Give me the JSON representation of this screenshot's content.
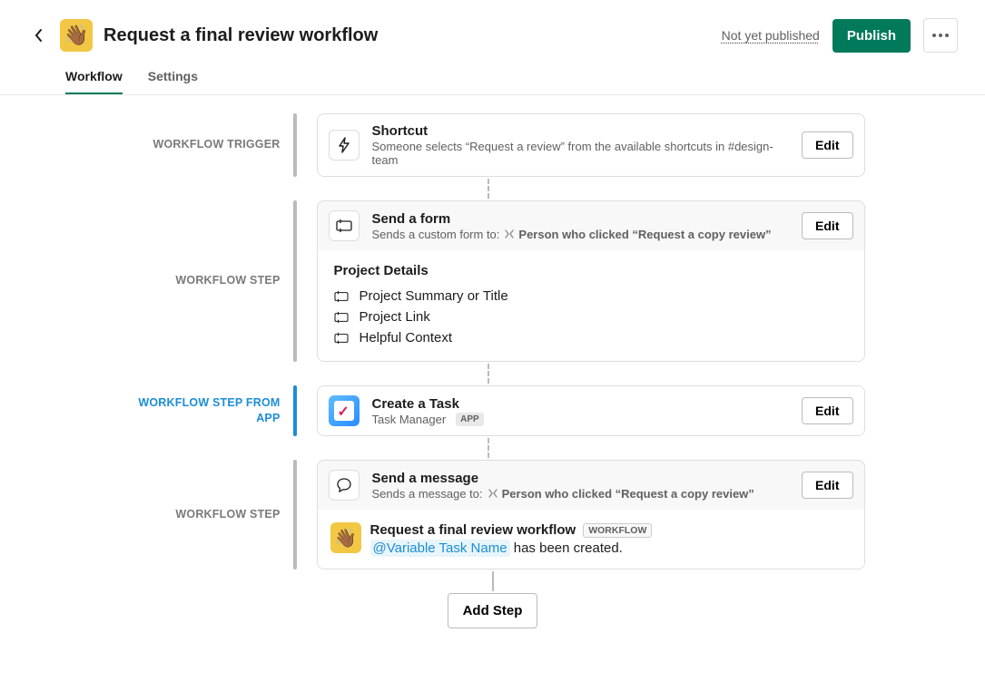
{
  "header": {
    "emoji": "👋🏾",
    "title": "Request a final review workflow",
    "status": "Not yet published",
    "publish_label": "Publish"
  },
  "tabs": {
    "workflow": "Workflow",
    "settings": "Settings"
  },
  "labels": {
    "trigger": "WORKFLOW TRIGGER",
    "step": "WORKFLOW STEP",
    "step_from_app": "WORKFLOW STEP FROM APP",
    "edit": "Edit",
    "add_step": "Add Step"
  },
  "trigger": {
    "title": "Shortcut",
    "desc": "Someone selects “Request a review” from the available shortcuts in #design-team"
  },
  "form": {
    "title": "Send a form",
    "desc_prefix": "Sends a custom form to:",
    "recipient": "Person who clicked “Request a copy review”",
    "section_title": "Project Details",
    "fields": [
      "Project Summary or Title",
      "Project Link",
      "Helpful Context"
    ]
  },
  "app_step": {
    "title": "Create a Task",
    "app_name": "Task Manager",
    "app_badge": "APP"
  },
  "message": {
    "title": "Send a message",
    "desc_prefix": "Sends a message to:",
    "recipient": "Person who clicked “Request a copy review”",
    "workflow_name": "Request a final review workflow",
    "wf_badge": "WORKFLOW",
    "variable": "@Variable Task Name",
    "suffix": " has been created."
  }
}
